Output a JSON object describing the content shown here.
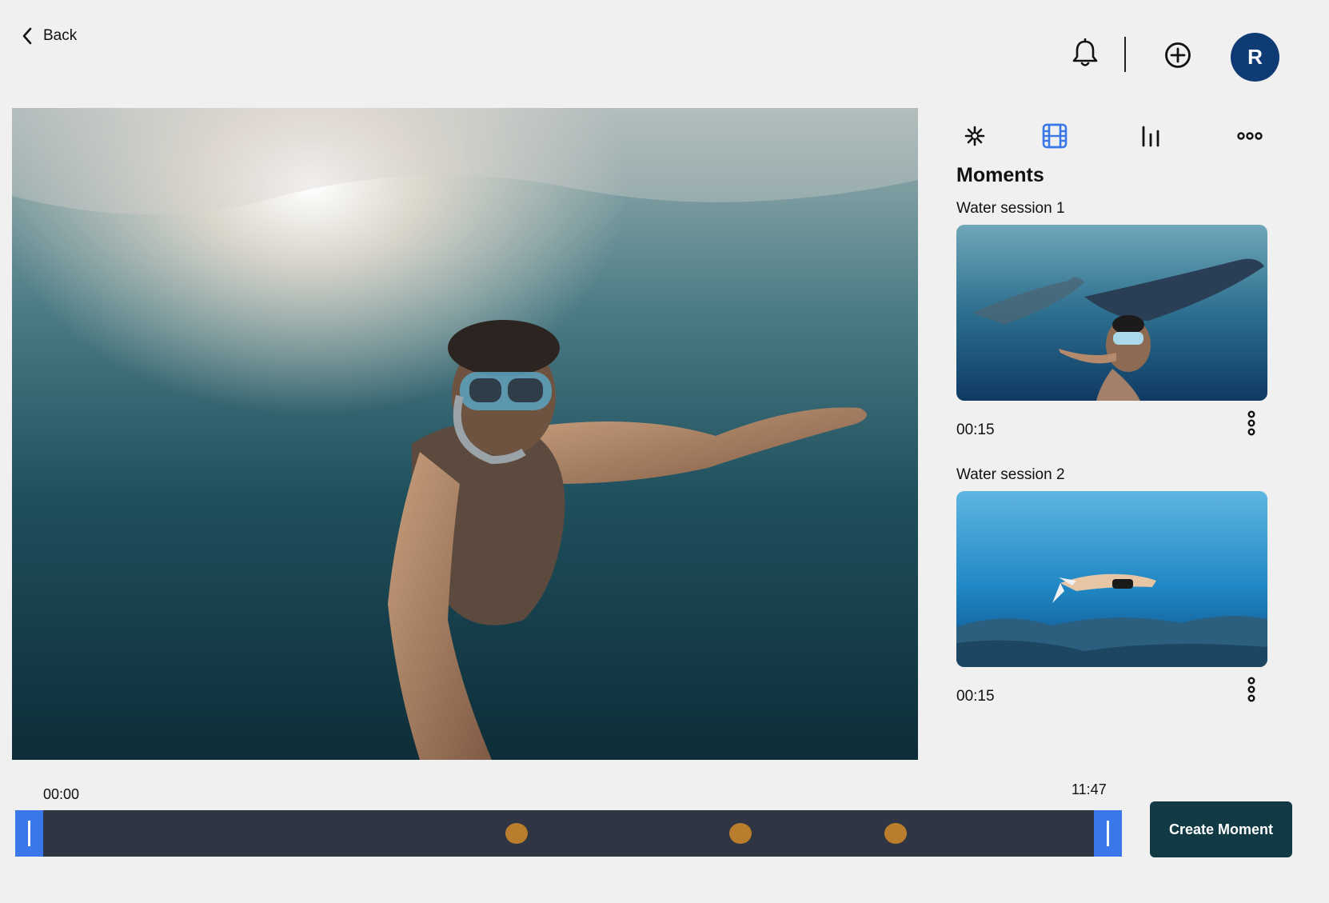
{
  "header": {
    "back_label": "Back",
    "avatar_initial": "R",
    "avatar_color": "#0e3b73"
  },
  "tools": {
    "tabs": [
      {
        "icon": "sparkle-icon",
        "active": false
      },
      {
        "icon": "film-icon",
        "active": true
      },
      {
        "icon": "bar-chart-icon",
        "active": false
      },
      {
        "icon": "more-horizontal-icon",
        "active": false
      }
    ],
    "active_color": "#3a78ea"
  },
  "moments": {
    "title": "Moments",
    "items": [
      {
        "label": "Water session 1",
        "duration": "00:15"
      },
      {
        "label": "Water session 2",
        "duration": "00:15"
      }
    ]
  },
  "timeline": {
    "start": "00:00",
    "end": "11:47",
    "marker_color": "#b97d2c",
    "handle_color": "#3a78ea"
  },
  "actions": {
    "create_label": "Create Moment"
  }
}
